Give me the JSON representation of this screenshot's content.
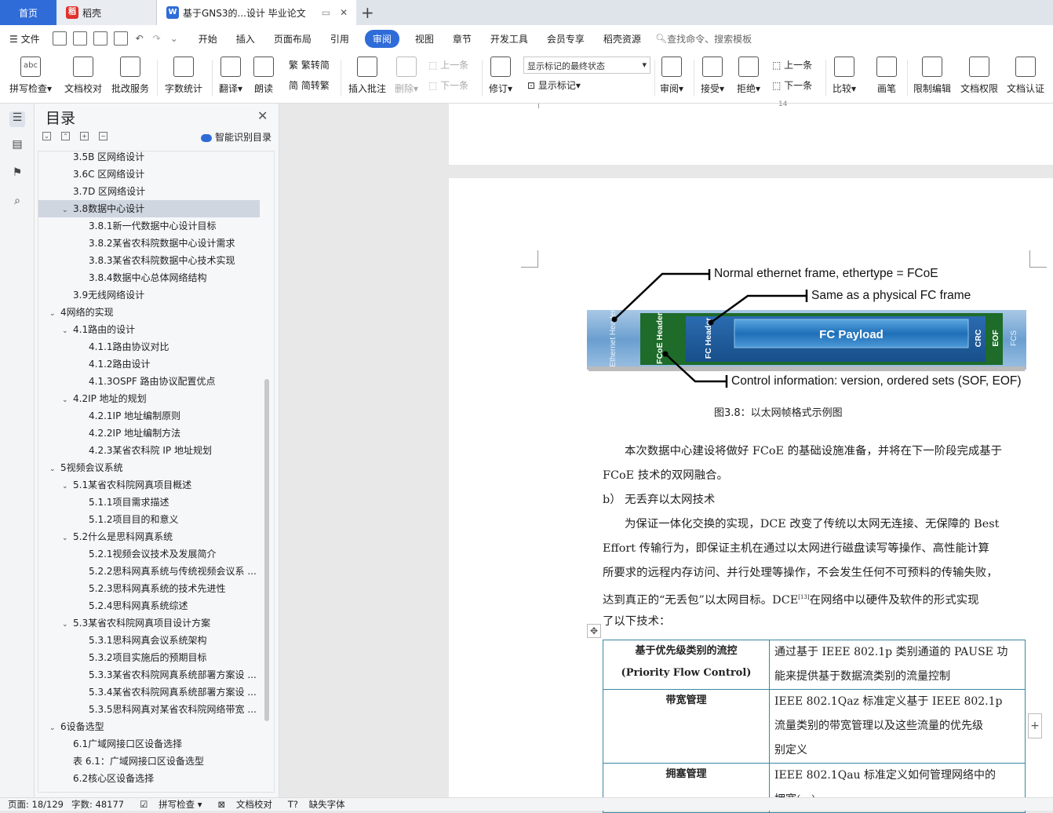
{
  "tabs": {
    "home": "首页",
    "daoke": "稻壳",
    "doc": "基于GNS3的...设计 毕业论文"
  },
  "menu": {
    "file": "文件",
    "items": [
      "开始",
      "插入",
      "页面布局",
      "引用",
      "审阅",
      "视图",
      "章节",
      "开发工具",
      "会员专享",
      "稻壳资源"
    ],
    "active": "审阅",
    "search": "查找命令、搜索模板"
  },
  "ribbon": {
    "spell": "拼写检查",
    "proof": "文档校对",
    "batch": "批改服务",
    "wordcount": "字数统计",
    "translate": "翻译",
    "read": "朗读",
    "trad": "繁转简",
    "simp": "简转繁",
    "insert_comment": "插入批注",
    "delete": "删除",
    "prev": "上一条",
    "next": "下一条",
    "revise": "修订",
    "mark_state": "显示标记的最终状态",
    "show_marks": "显示标记",
    "review": "审阅",
    "accept": "接受",
    "reject": "拒绝",
    "prev2": "上一条",
    "next2": "下一条",
    "compare": "比较",
    "pen": "画笔",
    "restrict": "限制编辑",
    "perm": "文档权限",
    "auth": "文档认证",
    "abc": "abc"
  },
  "nav": {
    "title": "目录",
    "smart": "智能识别目录",
    "items": [
      {
        "t": "3.5B 区网络设计",
        "lvl": 2
      },
      {
        "t": "3.6C 区网络设计",
        "lvl": 2
      },
      {
        "t": "3.7D 区网络设计",
        "lvl": 2
      },
      {
        "t": "3.8数据中心设计",
        "lvl": 2,
        "open": true,
        "sel": true
      },
      {
        "t": "3.8.1新一代数据中心设计目标",
        "lvl": 3
      },
      {
        "t": "3.8.2某省农科院数据中心设计需求",
        "lvl": 3
      },
      {
        "t": "3.8.3某省农科院数据中心技术实现",
        "lvl": 3
      },
      {
        "t": "3.8.4数据中心总体网络结构",
        "lvl": 3
      },
      {
        "t": "3.9无线网络设计",
        "lvl": 2
      },
      {
        "t": "4网络的实现",
        "lvl": 1,
        "open": true
      },
      {
        "t": "4.1路由的设计",
        "lvl": 2,
        "open": true
      },
      {
        "t": "4.1.1路由协议对比",
        "lvl": 3
      },
      {
        "t": "4.1.2路由设计",
        "lvl": 3
      },
      {
        "t": "4.1.3OSPF 路由协议配置优点",
        "lvl": 3
      },
      {
        "t": "4.2IP 地址的规划",
        "lvl": 2,
        "open": true
      },
      {
        "t": "4.2.1IP 地址编制原则",
        "lvl": 3
      },
      {
        "t": "4.2.2IP 地址编制方法",
        "lvl": 3
      },
      {
        "t": "4.2.3某省农科院 IP 地址规划",
        "lvl": 3
      },
      {
        "t": "5视频会议系统",
        "lvl": 1,
        "open": true
      },
      {
        "t": "5.1某省农科院网真项目概述",
        "lvl": 2,
        "open": true
      },
      {
        "t": "5.1.1项目需求描述",
        "lvl": 3
      },
      {
        "t": "5.1.2项目目的和意义",
        "lvl": 3
      },
      {
        "t": "5.2什么是思科网真系统",
        "lvl": 2,
        "open": true
      },
      {
        "t": "5.2.1视频会议技术及发展简介",
        "lvl": 3
      },
      {
        "t": "5.2.2思科网真系统与传统视频会议系 ...",
        "lvl": 3
      },
      {
        "t": "5.2.3思科网真系统的技术先进性",
        "lvl": 3
      },
      {
        "t": "5.2.4思科网真系统综述",
        "lvl": 3
      },
      {
        "t": "5.3某省农科院网真项目设计方案",
        "lvl": 2,
        "open": true
      },
      {
        "t": "5.3.1思科网真会议系统架构",
        "lvl": 3
      },
      {
        "t": "5.3.2项目实施后的预期目标",
        "lvl": 3
      },
      {
        "t": "5.3.3某省农科院网真系统部署方案设 ...",
        "lvl": 3
      },
      {
        "t": "5.3.4某省农科院网真系统部署方案设 ...",
        "lvl": 3
      },
      {
        "t": "5.3.5思科网真对某省农科院网络带宽 ...",
        "lvl": 3
      },
      {
        "t": "6设备选型",
        "lvl": 1,
        "open": true
      },
      {
        "t": "6.1广域网接口区设备选择",
        "lvl": 2
      },
      {
        "t": "表 6.1：广域网接口区设备选型",
        "lvl": 2
      },
      {
        "t": "6.2核心区设备选择",
        "lvl": 2
      }
    ]
  },
  "doc": {
    "page_number": "14",
    "figure": {
      "label_top": "Normal ethernet frame, ethertype = FCoE",
      "label_mid": "Same as a physical FC frame",
      "label_bottom": "Control information: version, ordered sets (SOF, EOF)",
      "eth_header": "Ethernet Header",
      "fcoe_header": "FCoE Header",
      "fc_header": "FC Header",
      "payload": "FC Payload",
      "crc": "CRC",
      "eof": "EOF",
      "fcs": "FCS",
      "caption": "图3.8：以太网帧格式示例图"
    },
    "para1_l1": "本次数据中心建设将做好 FCoE 的基础设施准备，并将在下一阶段完成基于",
    "para1_l2": "FCoE 技术的双网融合。",
    "heading_b": "b）  无丢弃以太网技术",
    "para2_l1": "为保证一体化交换的实现，DCE 改变了传统以太网无连接、无保障的 Best",
    "para2_l2": "Effort 传输行为，即保证主机在通过以太网进行磁盘读写等操作、高性能计算",
    "para2_l3": "所要求的远程内存访问、并行处理等操作，不会发生任何不可预料的传输失败，",
    "para2_l4": "达到真正的“无丢包”以太网目标。DCE",
    "para2_ref": "[13]",
    "para2_l4b": "在网络中以硬件及软件的形式实现",
    "para2_l5": "了以下技术：",
    "table": [
      {
        "k1": "基于优先级类别的流控",
        "k2": "(Priority Flow Control)",
        "v": [
          "通过基于 IEEE 802.1p 类别通道的 PAUSE 功",
          "能来提供基于数据流类别的流量控制"
        ]
      },
      {
        "k1": "带宽管理",
        "k2": "",
        "v": [
          "IEEE 802.1Qaz 标准定义基于 IEEE 802.1p",
          "流量类别的带宽管理以及这些流量的优先级",
          "别定义"
        ]
      },
      {
        "k1": "拥塞管理",
        "k2": "",
        "v": [
          "IEEE 802.1Qau 标准定义如何管理网络中的",
          "拥塞(...)"
        ]
      }
    ]
  },
  "status": {
    "page": "页面: 18/129",
    "words": "字数: 48177",
    "spell": "拼写检查",
    "proof": "文档校对",
    "font": "缺失字体"
  },
  "colors": {
    "accent": "#2f6cd8",
    "frame_green": "#1e6b2a",
    "payload_blue": "#2c83c7",
    "eth_blue": "#7fb0d9"
  }
}
